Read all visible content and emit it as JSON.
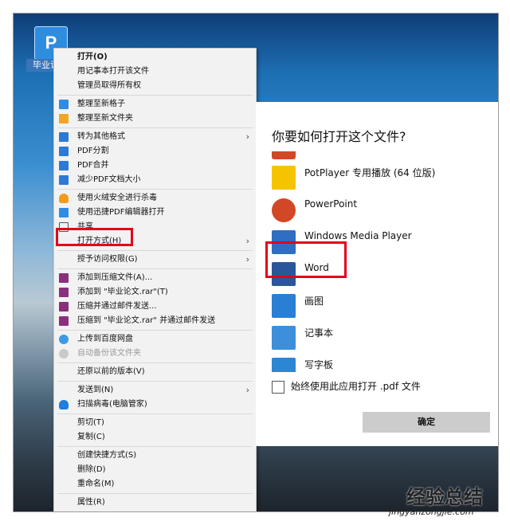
{
  "desktop": {
    "file_icon_letter": "P",
    "file_label": "毕业论文"
  },
  "context_menu": {
    "items": [
      {
        "label": "打开(O)",
        "bold": true
      },
      {
        "label": "用记事本打开该文件"
      },
      {
        "label": "管理员取得所有权"
      },
      {
        "label": "整理至新格子"
      },
      {
        "label": "整理至新文件夹"
      },
      {
        "label": "转为其他格式"
      },
      {
        "label": "PDF分割"
      },
      {
        "label": "PDF合并"
      },
      {
        "label": "减少PDF文档大小"
      },
      {
        "label": "使用火绒安全进行杀毒"
      },
      {
        "label": "使用迅捷PDF编辑器打开"
      },
      {
        "label": "共享"
      },
      {
        "label": "打开方式(H)"
      },
      {
        "label": "授予访问权限(G)"
      },
      {
        "label": "添加到压缩文件(A)..."
      },
      {
        "label": "添加到 \"毕业论文.rar\"(T)"
      },
      {
        "label": "压缩并通过邮件发送..."
      },
      {
        "label": "压缩到 \"毕业论文.rar\" 并通过邮件发送"
      },
      {
        "label": "上传到百度网盘"
      },
      {
        "label": "自动备份该文件夹"
      },
      {
        "label": "还原以前的版本(V)"
      },
      {
        "label": "发送到(N)"
      },
      {
        "label": "扫描病毒(电脑管家)"
      },
      {
        "label": "剪切(T)"
      },
      {
        "label": "复制(C)"
      },
      {
        "label": "创建快捷方式(S)"
      },
      {
        "label": "删除(D)"
      },
      {
        "label": "重命名(M)"
      },
      {
        "label": "属性(R)"
      }
    ],
    "submenu_arrow": "›"
  },
  "open_with_dialog": {
    "title": "你要如何打开这个文件?",
    "apps": [
      {
        "name": "PotPlayer 专用播放 (64 位版)",
        "icon": "potplayer-icon",
        "color": "#f5c400"
      },
      {
        "name": "PowerPoint",
        "icon": "powerpoint-icon",
        "color": "#d24726"
      },
      {
        "name": "Windows Media Player",
        "icon": "media-player-icon",
        "color": "#2f6ec1"
      },
      {
        "name": "Word",
        "icon": "word-icon",
        "color": "#2b579a"
      },
      {
        "name": "画图",
        "icon": "paint-icon",
        "color": "#2a7fd4"
      },
      {
        "name": "记事本",
        "icon": "notepad-icon",
        "color": "#3c8fd8"
      },
      {
        "name": "写字板",
        "icon": "wordpad-icon",
        "color": "#2d86d4"
      }
    ],
    "always_use_label": "始终使用此应用打开 .pdf 文件",
    "always_use_checked": false,
    "ok_button": "确定"
  },
  "watermark": {
    "title": "经验总结",
    "url": "jingyanzongjie.com"
  },
  "colors": {
    "highlight_box": "#e3001b",
    "menu_bg": "#f2f2f2",
    "desktop_top": "#1d6fb3"
  }
}
